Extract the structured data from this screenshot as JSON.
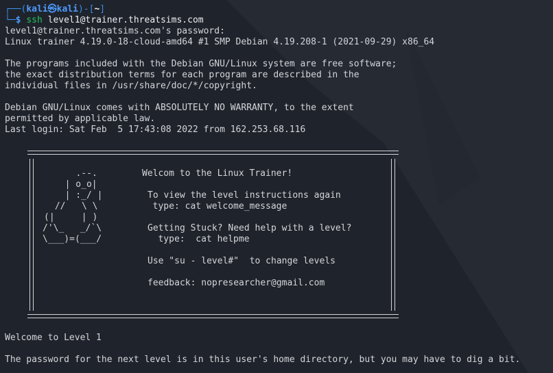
{
  "prompt": {
    "user": "kali",
    "host": "kali",
    "cwd": "~",
    "symbol": "$",
    "command": "ssh level1@trainer.threatsims.com"
  },
  "output": {
    "password_prompt": "level1@trainer.threatsims.com's password:",
    "uname": "Linux trainer 4.19.0-18-cloud-amd64 #1 SMP Debian 4.19.208-1 (2021-09-29) x86_64",
    "motd_1": "The programs included with the Debian GNU/Linux system are free software;",
    "motd_2": "the exact distribution terms for each program are described in the",
    "motd_3": "individual files in /usr/share/doc/*/copyright.",
    "motd_4": "Debian GNU/Linux comes with ABSOLUTELY NO WARRANTY, to the extent",
    "motd_5": "permitted by applicable law.",
    "last_login": "Last login: Sat Feb  5 17:43:08 2022 from 162.253.68.116"
  },
  "banner": {
    "art": [
      "   .--.",
      "  | o_o|",
      "  | :_/ |",
      " //   \\ \\",
      "(|     | )",
      "/'\\_   _/`\\",
      "\\___)=(___/"
    ],
    "welcome": "Welcom to the Linux Trainer!",
    "view_instructions": "To view the level instructions again",
    "view_command": "  type: cat welcome_message",
    "stuck": "Getting Stuck? Need help with a level?",
    "stuck_command": "   type:  cat helpme",
    "su_hint": "Use \"su - level#\"  to change levels",
    "feedback": "feedback: nopresearcher@gmail.com"
  },
  "footer": {
    "welcome_level": "Welcome to Level 1",
    "hint": "The password for the next level is in this user's home directory, but you may have to dig a bit."
  },
  "colors": {
    "background": "#1f232b",
    "text": "#d4d6da",
    "prompt_blue": "#3b8eea",
    "prompt_green": "#22c55e"
  }
}
